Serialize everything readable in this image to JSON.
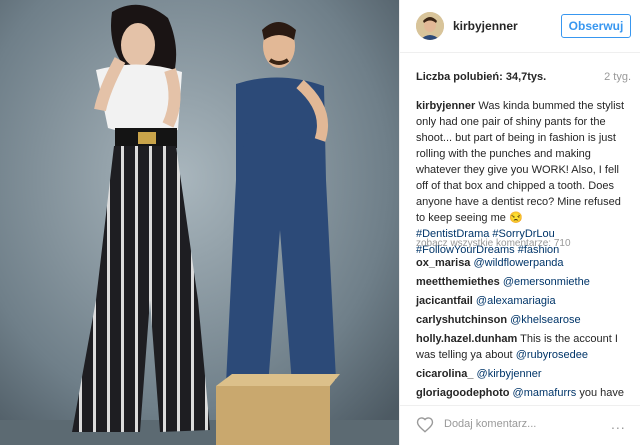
{
  "post": {
    "username": "kirbyjenner",
    "follow_label": "Obserwuj",
    "likes_label": "Liczba polubień: 34,7tys.",
    "time_ago": "2 tyg.",
    "caption_user": "kirbyjenner",
    "caption_text": "Was kinda bummed the stylist only had one pair of shiny pants for the shoot... but part of being in fashion is just rolling with the punches and making whatever they give you WORK! Also, I fell off of that box and chipped a tooth. Does anyone have a dentist reco? Mine refused to keep seeing me 😒",
    "hashtags": [
      "#DentistDrama",
      "#SorryDrLou",
      "#FollowYourDreams",
      "#fashion"
    ]
  },
  "comments_section": {
    "view_all_label": "zobacz wszystkie komentarze: 710",
    "items": [
      {
        "user": "ox_marisa",
        "text": "",
        "mention": "@wildflowerpanda"
      },
      {
        "user": "meetthemiethes",
        "text": "",
        "mention": "@emersonmiethe"
      },
      {
        "user": "jacicantfail",
        "text": "",
        "mention": "@alexamariagia"
      },
      {
        "user": "carlyshutchinson",
        "text": "",
        "mention": "@khelsearose"
      },
      {
        "user": "holly.hazel.dunham",
        "text": "This is the account I was telling ya about",
        "mention": "@rubyrosedee"
      },
      {
        "user": "cicarolina_",
        "text": "",
        "mention": "@kirbyjenner"
      },
      {
        "user": "gloriagoodephoto",
        "text": "",
        "mention": "@mamafurrs",
        "suffix": "you have"
      }
    ]
  },
  "footer": {
    "add_comment_placeholder": "Dodaj komentarz...",
    "more_label": "..."
  },
  "icons": {
    "heart": "heart-icon",
    "more": "more-options-icon"
  },
  "colors": {
    "link": "#003569",
    "follow": "#3897f0",
    "photo_bg": "#7f8f99"
  }
}
